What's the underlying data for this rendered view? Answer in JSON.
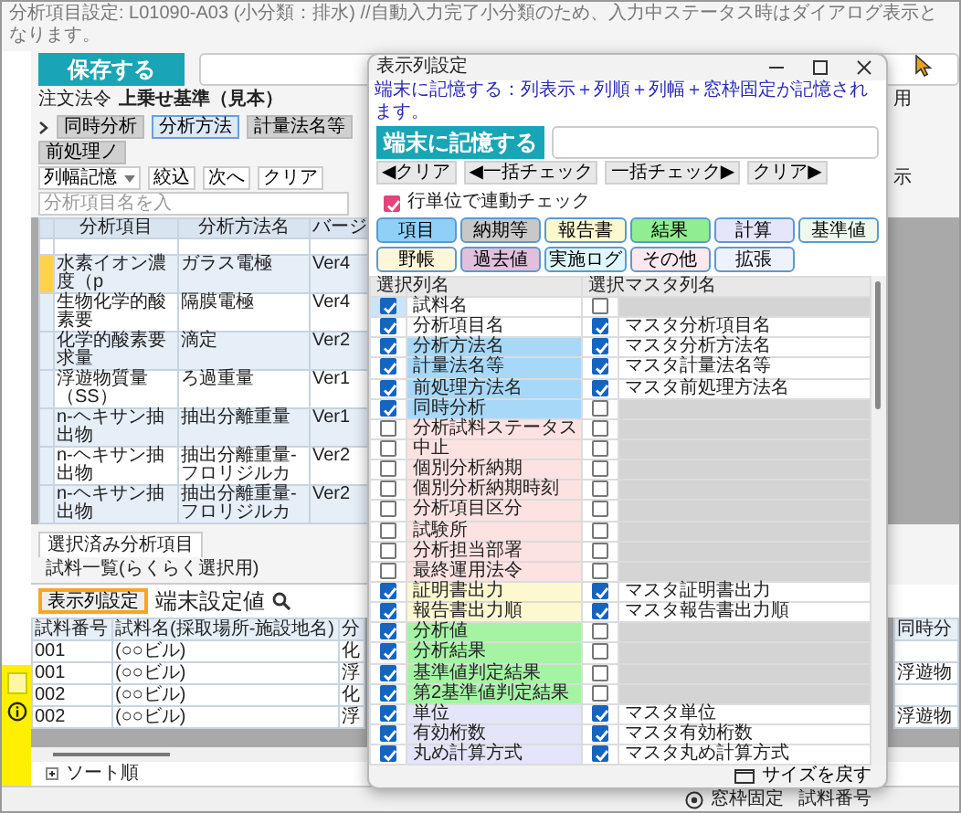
{
  "header": {
    "title": "分析項目設定: L01090-A03 (小分類：排水) //自動入力完了小分類のため、入力中ステータス時はダイアログ表示となります。",
    "save_button": "保存する",
    "law_label": "注文法令",
    "law_value": "上乗せ基準（見本）",
    "side_text": "用"
  },
  "category_tabs": [
    {
      "label": "同時分析",
      "selected": false
    },
    {
      "label": "分析方法",
      "selected": true
    },
    {
      "label": "計量法名等",
      "selected": false
    },
    {
      "label": "前処理ノ",
      "selected": false
    }
  ],
  "toolbar": {
    "column_width_menu": "列幅記憶",
    "filter_button": "絞込",
    "next_button": "次へ",
    "clear_button": "クリア",
    "search_placeholder": "分析項目名を入",
    "side_text": "示"
  },
  "item_grid": {
    "columns": [
      "分析項目",
      "分析方法名",
      "バージ"
    ],
    "rows": [
      {
        "cells": [
          "水素イオン濃度（p",
          "ガラス電極",
          "Ver4"
        ],
        "flagged": true
      },
      {
        "cells": [
          "生物化学的酸素要",
          "隔膜電極",
          "Ver4"
        ],
        "flagged": false
      },
      {
        "cells": [
          "化学的酸素要求量",
          "滴定",
          "Ver2"
        ],
        "flagged": false
      },
      {
        "cells": [
          "浮遊物質量（SS）",
          "ろ過重量",
          "Ver1"
        ],
        "flagged": false
      },
      {
        "cells": [
          "n-ヘキサン抽出物",
          "抽出分離重量",
          "Ver1"
        ],
        "flagged": false
      },
      {
        "cells": [
          "n-ヘキサン抽出物",
          "抽出分離重量-フロリジルカ",
          "Ver2"
        ],
        "flagged": false
      },
      {
        "cells": [
          "n-ヘキサン抽出物",
          "抽出分離重量-フロリジルカ",
          "Ver2"
        ],
        "flagged": false
      }
    ]
  },
  "lower_tabs": [
    {
      "label": "選択済み分析項目",
      "selected": true
    },
    {
      "label": "試料一覧(らくらく選択用)",
      "selected": false
    }
  ],
  "sample_toolbar": {
    "column_settings_button": "表示列設定",
    "highlighted": true,
    "value": "端末設定値"
  },
  "sample_grid": {
    "columns": [
      "試料番号",
      "試料名(採取場所-施設地名)",
      "分"
    ],
    "column_4": "同時分",
    "rows": [
      {
        "cells": [
          "001",
          "(○○ビル)",
          "化"
        ]
      },
      {
        "cells": [
          "001",
          "(○○ビル)",
          "浮"
        ],
        "column_4": "浮遊物"
      },
      {
        "cells": [
          "002",
          "(○○ビル)",
          "化"
        ]
      },
      {
        "cells": [
          "002",
          "(○○ビル)",
          "浮"
        ],
        "column_4": "浮遊物"
      }
    ]
  },
  "footer": {
    "sort_label": "ソート順",
    "pane_lock": "窓枠固定",
    "status_field": "試料番号"
  },
  "dialog": {
    "title": "表示列設定",
    "note": "端末に記憶する：列表示＋列順＋列幅＋窓枠固定が記憶されます。",
    "save_button": "端末に記憶する",
    "bulk_buttons": [
      "◀クリア",
      "◀一括チェック",
      "一括チェック▶",
      "クリア▶"
    ],
    "link_check": {
      "label": "行単位で連動チェック",
      "checked": true
    },
    "groups": [
      {
        "label": "項目",
        "color": "#90d0f8"
      },
      {
        "label": "納期等",
        "color": "#c8c8c8"
      },
      {
        "label": "報告書",
        "color": "#fdf8d0"
      },
      {
        "label": "結果",
        "color": "#90ee90"
      },
      {
        "label": "計算",
        "color": "#e6e6fa"
      },
      {
        "label": "基準値",
        "color": "#eef8ee"
      },
      {
        "label": "野帳",
        "color": "#fdf6d8"
      },
      {
        "label": "過去値",
        "color": "#e0c0dc"
      },
      {
        "label": "実施ログ",
        "color": "#e0f8fc"
      },
      {
        "label": "その他",
        "color": "#fde8ee"
      },
      {
        "label": "拡張",
        "color": "#eef2fc"
      }
    ],
    "columns": [
      "選択",
      "列名",
      "選択",
      "マスタ列名"
    ],
    "rows": [
      {
        "name": "試料名",
        "checked": true,
        "color": "#ffffff",
        "master_checked": false,
        "selected": true
      },
      {
        "name": "分析項目名",
        "checked": true,
        "color": "#ffffff",
        "master_checked": true,
        "master": "マスタ分析項目名",
        "selected": false
      },
      {
        "name": "分析方法名",
        "checked": true,
        "color": "#a8d8f8",
        "master_checked": true,
        "master": "マスタ分析方法名",
        "selected": false
      },
      {
        "name": "計量法名等",
        "checked": true,
        "color": "#a8d8f8",
        "master_checked": true,
        "master": "マスタ計量法名等",
        "selected": false
      },
      {
        "name": "前処理方法名",
        "checked": true,
        "color": "#a8d8f8",
        "master_checked": true,
        "master": "マスタ前処理方法名",
        "selected": false
      },
      {
        "name": "同時分析",
        "checked": true,
        "color": "#a8d8f8",
        "master_checked": false,
        "selected": false
      },
      {
        "name": "分析試料ステータス",
        "checked": false,
        "color": "#fde2e2",
        "master_checked": false,
        "selected": false
      },
      {
        "name": "中止",
        "checked": false,
        "color": "#fde2e2",
        "master_checked": false,
        "selected": false
      },
      {
        "name": "個別分析納期",
        "checked": false,
        "color": "#fde2e2",
        "master_checked": false,
        "selected": false
      },
      {
        "name": "個別分析納期時刻",
        "checked": false,
        "color": "#fde2e2",
        "master_checked": false,
        "selected": false
      },
      {
        "name": "分析項目区分",
        "checked": false,
        "color": "#fde2e2",
        "master_checked": false,
        "selected": false
      },
      {
        "name": "試験所",
        "checked": false,
        "color": "#fde2e2",
        "master_checked": false,
        "selected": false
      },
      {
        "name": "分析担当部署",
        "checked": false,
        "color": "#fde2e2",
        "master_checked": false,
        "selected": false
      },
      {
        "name": "最終運用法令",
        "checked": false,
        "color": "#fde2e2",
        "master_checked": false,
        "selected": false
      },
      {
        "name": "証明書出力",
        "checked": true,
        "color": "#fdf8d0",
        "master_checked": true,
        "master": "マスタ証明書出力",
        "selected": false
      },
      {
        "name": "報告書出力順",
        "checked": true,
        "color": "#fdf8d0",
        "master_checked": true,
        "master": "マスタ報告書出力順",
        "selected": false
      },
      {
        "name": "分析値",
        "checked": true,
        "color": "#a4f4a4",
        "master_checked": false,
        "selected": false
      },
      {
        "name": "分析結果",
        "checked": true,
        "color": "#a4f4a4",
        "master_checked": false,
        "selected": false
      },
      {
        "name": "基準値判定結果",
        "checked": true,
        "color": "#a4f4a4",
        "master_checked": false,
        "selected": false
      },
      {
        "name": "第2基準値判定結果",
        "checked": true,
        "color": "#a4f4a4",
        "master_checked": false,
        "selected": false
      },
      {
        "name": "単位",
        "checked": true,
        "color": "#e4e4fa",
        "master_checked": true,
        "master": "マスタ単位",
        "selected": false
      },
      {
        "name": "有効桁数",
        "checked": true,
        "color": "#e4e4fa",
        "master_checked": true,
        "master": "マスタ有効桁数",
        "selected": false
      },
      {
        "name": "丸め計算方式",
        "checked": true,
        "color": "#e4e4fa",
        "master_checked": true,
        "master": "マスタ丸め計算方式",
        "selected": false
      }
    ],
    "restore_button": "サイズを戻す"
  }
}
